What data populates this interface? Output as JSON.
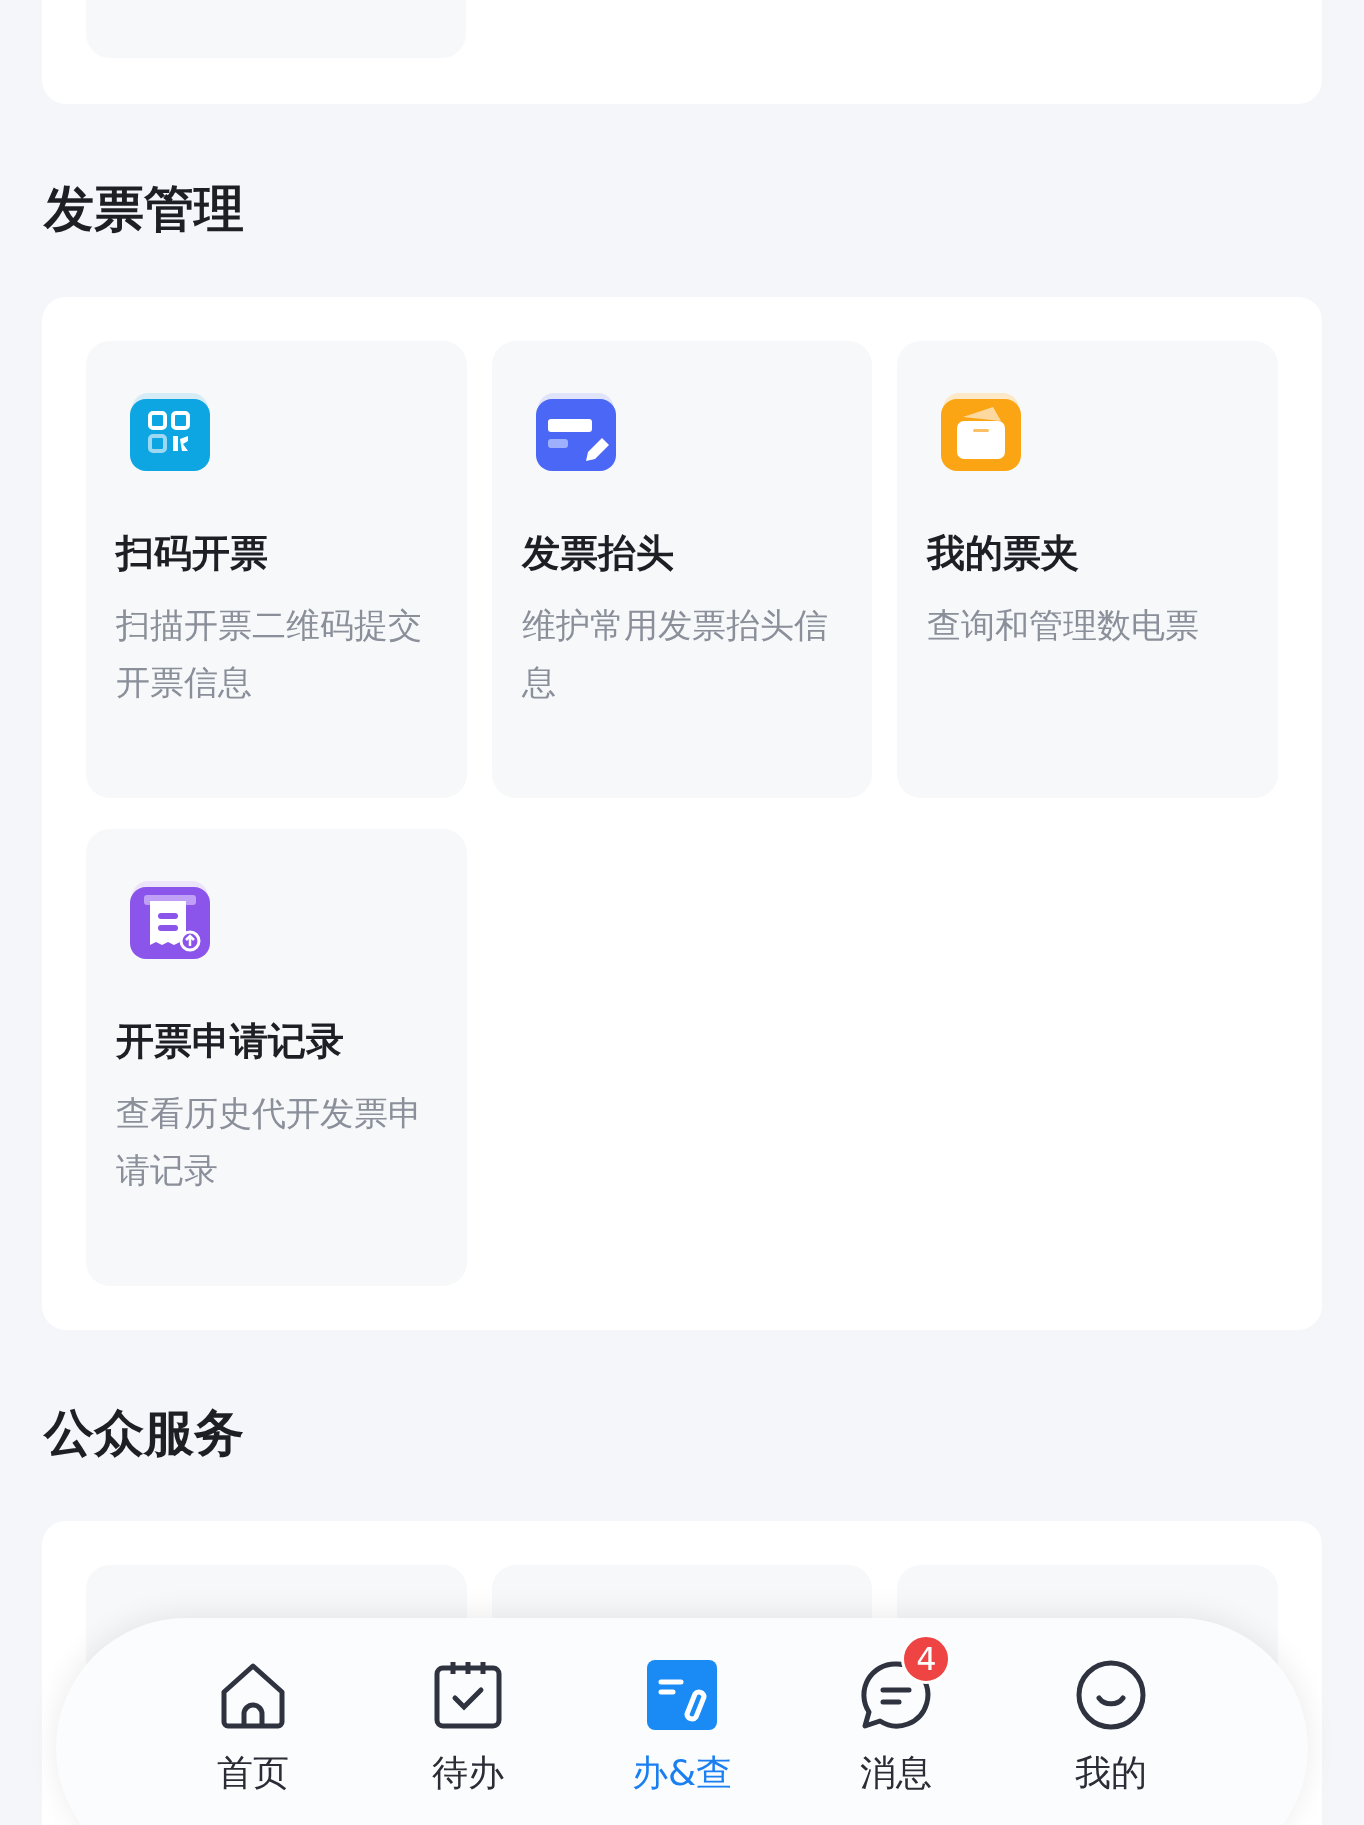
{
  "invoice_section": {
    "heading": "发票管理",
    "items": [
      {
        "title": "扫码开票",
        "description": "扫描开票二维码提交开票信息"
      },
      {
        "title": "发票抬头",
        "description": "维护常用发票抬头信息"
      },
      {
        "title": "我的票夹",
        "description": "查询和管理数电票"
      },
      {
        "title": "开票申请记录",
        "description": "查看历史代开发票申请记录"
      }
    ]
  },
  "public_section": {
    "heading": "公众服务"
  },
  "bottom_nav": [
    {
      "label": "首页",
      "selected": false
    },
    {
      "label": "待办",
      "selected": false
    },
    {
      "label": "办&查",
      "selected": true
    },
    {
      "label": "消息",
      "selected": false,
      "badge": "4"
    },
    {
      "label": "我的",
      "selected": false
    }
  ]
}
